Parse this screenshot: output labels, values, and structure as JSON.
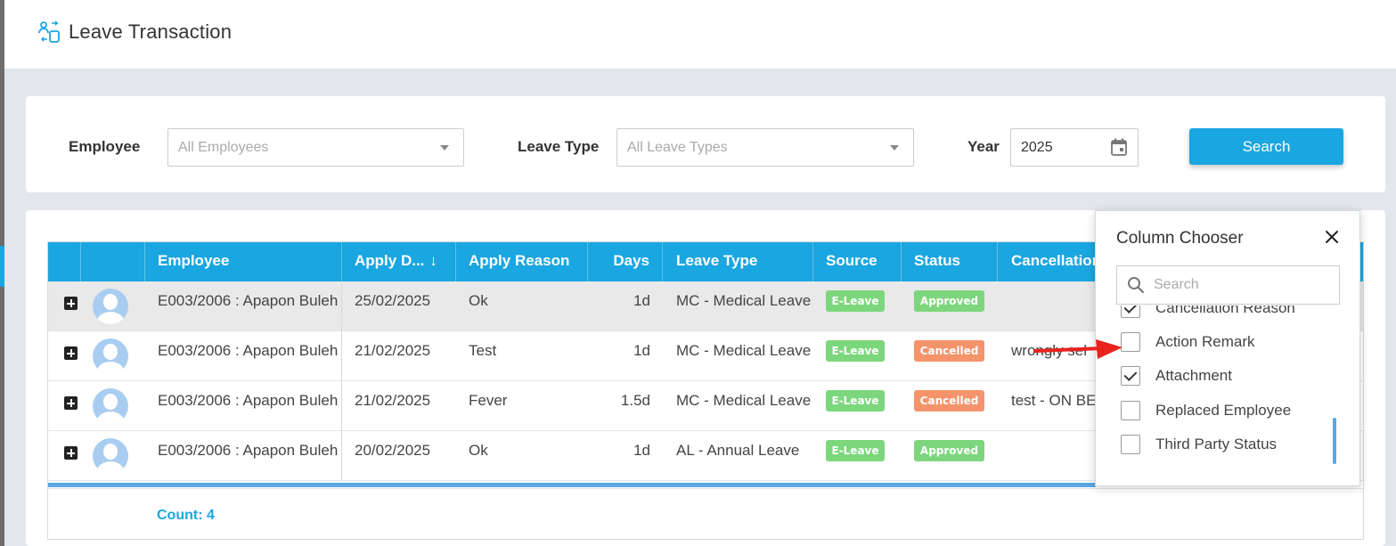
{
  "page": {
    "title": "Leave Transaction"
  },
  "filters": {
    "employee_label": "Employee",
    "employee_placeholder": "All Employees",
    "leave_type_label": "Leave Type",
    "leave_type_placeholder": "All Leave Types",
    "year_label": "Year",
    "year_value": "2025",
    "search_label": "Search"
  },
  "grid": {
    "columns": [
      "Employee",
      "Apply D...",
      "Apply Reason",
      "Days",
      "Leave Type",
      "Source",
      "Status",
      "Cancellation"
    ],
    "sort_indicator": "↓",
    "rows": [
      {
        "employee": "E003/2006 : Apapon Buleh",
        "apply_date": "25/02/2025",
        "reason": "Ok",
        "days": "1d",
        "leave_type": "MC - Medical Leave",
        "source": "E-Leave",
        "status": "Approved",
        "cancellation": ""
      },
      {
        "employee": "E003/2006 : Apapon Buleh",
        "apply_date": "21/02/2025",
        "reason": "Test",
        "days": "1d",
        "leave_type": "MC - Medical Leave",
        "source": "E-Leave",
        "status": "Cancelled",
        "cancellation": "wrongly sel"
      },
      {
        "employee": "E003/2006 : Apapon Buleh",
        "apply_date": "21/02/2025",
        "reason": "Fever",
        "days": "1.5d",
        "leave_type": "MC - Medical Leave",
        "source": "E-Leave",
        "status": "Cancelled",
        "cancellation": "test - ON BEH"
      },
      {
        "employee": "E003/2006 : Apapon Buleh",
        "apply_date": "20/02/2025",
        "reason": "Ok",
        "days": "1d",
        "leave_type": "AL - Annual Leave",
        "source": "E-Leave",
        "status": "Approved",
        "cancellation": ""
      }
    ],
    "footer": {
      "count": "Count: 4"
    }
  },
  "column_chooser": {
    "title": "Column Chooser",
    "search_placeholder": "Search",
    "items": [
      {
        "label": "Cancellation Reason",
        "checked": true
      },
      {
        "label": "Action Remark",
        "checked": false
      },
      {
        "label": "Attachment",
        "checked": true
      },
      {
        "label": "Replaced Employee",
        "checked": false
      },
      {
        "label": "Third Party Status",
        "checked": false
      }
    ]
  },
  "colors": {
    "accent": "#1aa6e0",
    "approved": "#7dd67d",
    "cancelled": "#f5936a",
    "source_badge": "#7cd77c",
    "annotation_arrow": "#e8231e"
  },
  "icons": {
    "page": "transaction-people-icon",
    "dropdown": "caret-down-icon",
    "calendar": "calendar-icon",
    "sort": "sort-down-icon",
    "expand": "plus-square-icon",
    "avatar": "user-avatar-icon",
    "close": "close-icon",
    "search": "search-icon",
    "annotation": "red-arrow-icon"
  }
}
